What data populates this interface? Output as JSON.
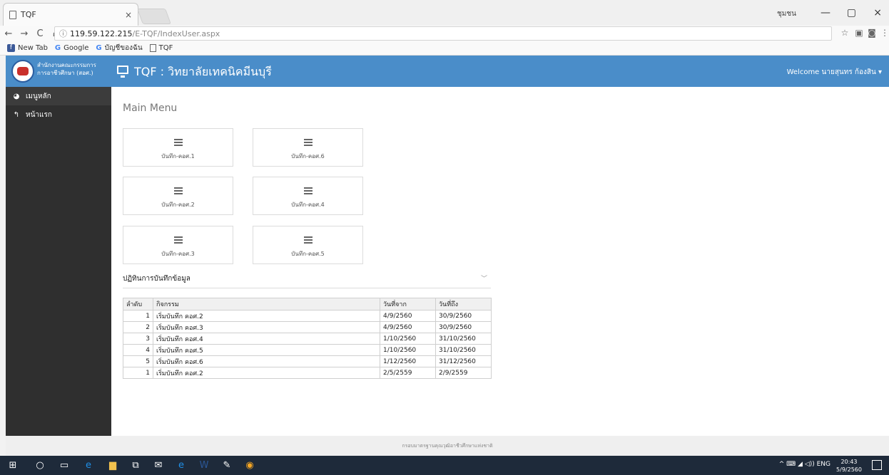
{
  "browser": {
    "tab_title": "TQF",
    "tab_close": "×",
    "window_user": "ชุมชน",
    "win_min": "—",
    "win_max": "▢",
    "win_close": "×",
    "url_host": "119.59.122.215",
    "url_path": "/E-TQF/IndexUser.aspx",
    "bookmarks": [
      "New Tab",
      "Google",
      "บัญชีของฉัน",
      "TQF"
    ]
  },
  "header": {
    "org_line1": "สำนักงานคณะกรรมการ",
    "org_line2": "การอาชีวศึกษา (สอศ.)",
    "title": "TQF : วิทยาลัยเทคนิคมีนบุรี",
    "welcome": "Welcome นายสุนทร ก้องสิน ▾"
  },
  "sidebar": {
    "items": [
      {
        "label": "เมนูหลัก",
        "icon": "dashboard-icon"
      },
      {
        "label": "หน้าแรก",
        "icon": "back-arrow-icon"
      }
    ]
  },
  "main": {
    "title": "Main Menu",
    "tiles": [
      "บันทึก-คอศ.1",
      "บันทึก-คอศ.6",
      "บันทึก-คอศ.2",
      "บันทึก-คอศ.4",
      "บันทึก-คอศ.3",
      "บันทึก-คอศ.5"
    ],
    "section_title": "ปฏิทินการบันทึกข้อมูล",
    "chevron": "﹀",
    "table": {
      "headers": [
        "ลำดับ",
        "กิจกรรม",
        "วันที่จาก",
        "วันที่ถึง"
      ],
      "rows": [
        [
          "1",
          "เริ่มบันทึก คอศ.2",
          "4/9/2560",
          "30/9/2560"
        ],
        [
          "2",
          "เริ่มบันทึก คอศ.3",
          "4/9/2560",
          "30/9/2560"
        ],
        [
          "3",
          "เริ่มบันทึก คอศ.4",
          "1/10/2560",
          "31/10/2560"
        ],
        [
          "4",
          "เริ่มบันทึก คอศ.5",
          "1/10/2560",
          "31/10/2560"
        ],
        [
          "5",
          "เริ่มบันทึก คอศ.6",
          "1/12/2560",
          "31/12/2560"
        ],
        [
          "1",
          "เริ่มบันทึก คอศ.2",
          "2/5/2559",
          "2/9/2559"
        ]
      ]
    }
  },
  "footer": {
    "text": "กรอบมาตรฐานคุณวุฒิอาชีวศึกษาแห่งชาติ"
  },
  "taskbar": {
    "tray": "^  ⌨  ◢  ◁))  ENG",
    "time": "20:43",
    "date": "5/9/2560"
  }
}
